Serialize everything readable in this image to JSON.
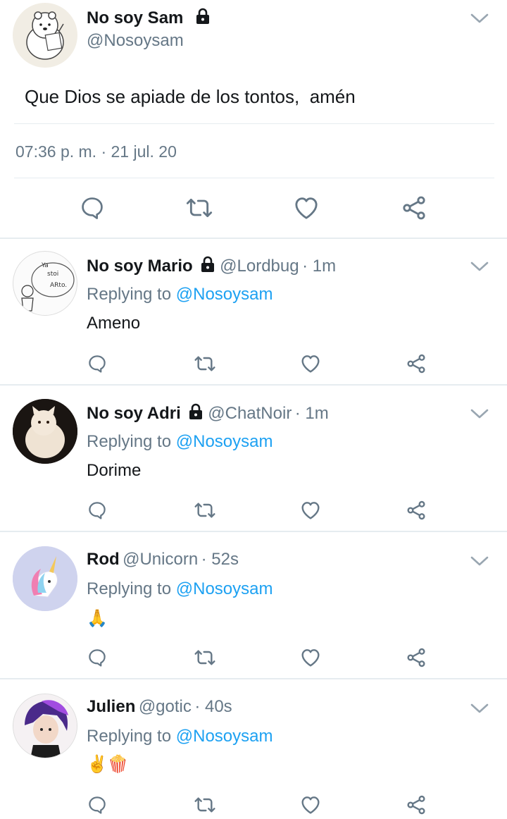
{
  "main_tweet": {
    "name": "No soy Sam",
    "handle": "@Nosoysam",
    "text": "Que Dios se apiade de los tontos,  amén",
    "timestamp": "07:36 p. m. · 21 jul. 20"
  },
  "replies": [
    {
      "name": "No soy Mario",
      "handle": "@Lordbug",
      "time": "· 1m",
      "replying_prefix": "Replying to",
      "replying_to": "@Nosoysam",
      "text": "Ameno"
    },
    {
      "name": "No soy Adri",
      "handle": "@ChatNoir",
      "time": "· 1m",
      "replying_prefix": "Replying to",
      "replying_to": "@Nosoysam",
      "text": "Dorime"
    },
    {
      "name": "Rod",
      "handle": "@Unicorn",
      "time": "· 52s",
      "replying_prefix": "Replying to",
      "replying_to": "@Nosoysam",
      "text": "🙏"
    },
    {
      "name": "Julien",
      "handle": "@gotic",
      "time": "· 40s",
      "replying_prefix": "Replying to",
      "replying_to": "@Nosoysam",
      "text": "✌️🍿"
    }
  ],
  "icons": [
    "reply-icon",
    "retweet-icon",
    "like-icon",
    "share-icon",
    "chevron-down-icon",
    "lock-icon"
  ],
  "colors": {
    "accent": "#1da1f2",
    "muted": "#657786",
    "divider": "#e6ecf0"
  }
}
